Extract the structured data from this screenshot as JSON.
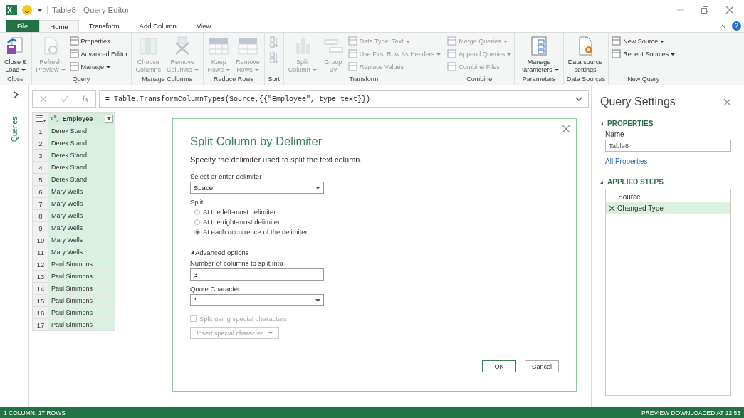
{
  "title_bar": {
    "title": "Table8 - Query Editor"
  },
  "menu_tabs": [
    {
      "label": "File",
      "kind": "file",
      "selected": false
    },
    {
      "label": "Home",
      "kind": "tab",
      "selected": true
    },
    {
      "label": "Transform",
      "kind": "tab",
      "selected": false
    },
    {
      "label": "Add Column",
      "kind": "tab",
      "selected": false
    },
    {
      "label": "View",
      "kind": "tab",
      "selected": false
    }
  ],
  "help": "?",
  "ribbon_groups": [
    {
      "label": "Close",
      "buttons": [
        {
          "kind": "large",
          "lines": [
            "Close &",
            "Load"
          ],
          "dropdown": true,
          "disabled": false
        }
      ]
    },
    {
      "label": "Query",
      "buttons": [
        {
          "kind": "large",
          "lines": [
            "Refresh",
            "Preview"
          ],
          "dropdown": true,
          "disabled": true
        },
        {
          "kind": "small",
          "lines": [
            "Properties"
          ],
          "dropdown": false,
          "disabled": false
        },
        {
          "kind": "small",
          "lines": [
            "Advanced Editor"
          ],
          "dropdown": false,
          "disabled": false
        },
        {
          "kind": "small",
          "lines": [
            "Manage"
          ],
          "dropdown": true,
          "disabled": false
        }
      ]
    },
    {
      "label": "Manage Columns",
      "buttons": [
        {
          "kind": "large",
          "lines": [
            "Choose",
            "Columns"
          ],
          "dropdown": false,
          "disabled": true
        },
        {
          "kind": "large",
          "lines": [
            "Remove",
            "Columns"
          ],
          "dropdown": true,
          "disabled": true
        }
      ]
    },
    {
      "label": "Reduce Rows",
      "buttons": [
        {
          "kind": "large",
          "lines": [
            "Keep",
            "Rows"
          ],
          "dropdown": true,
          "disabled": true
        },
        {
          "kind": "large",
          "lines": [
            "Remove",
            "Rows"
          ],
          "dropdown": true,
          "disabled": true
        }
      ]
    },
    {
      "label": "Sort",
      "buttons": [
        {
          "kind": "icon",
          "disabled": true
        },
        {
          "kind": "icon",
          "disabled": true
        }
      ]
    },
    {
      "label": "Transform",
      "buttons": [
        {
          "kind": "large",
          "lines": [
            "Split",
            "Column"
          ],
          "dropdown": true,
          "disabled": true
        },
        {
          "kind": "large",
          "lines": [
            "Group",
            "By"
          ],
          "dropdown": false,
          "disabled": true
        },
        {
          "kind": "small",
          "lines": [
            "Data Type: Text"
          ],
          "dropdown": true,
          "disabled": true
        },
        {
          "kind": "small",
          "lines": [
            "Use First Row As Headers"
          ],
          "dropdown": true,
          "disabled": true
        },
        {
          "kind": "small",
          "lines": [
            "Replace Values"
          ],
          "dropdown": false,
          "disabled": true
        }
      ]
    },
    {
      "label": "Combine",
      "buttons": [
        {
          "kind": "small",
          "lines": [
            "Merge Queries"
          ],
          "dropdown": true,
          "disabled": true
        },
        {
          "kind": "small",
          "lines": [
            "Append Queries"
          ],
          "dropdown": true,
          "disabled": true
        },
        {
          "kind": "small",
          "lines": [
            "Combine Files"
          ],
          "dropdown": false,
          "disabled": true
        }
      ]
    },
    {
      "label": "Parameters",
      "buttons": [
        {
          "kind": "large",
          "lines": [
            "Manage",
            "Parameters"
          ],
          "dropdown": true,
          "disabled": false
        }
      ]
    },
    {
      "label": "Data Sources",
      "buttons": [
        {
          "kind": "large",
          "lines": [
            "Data source",
            "settings"
          ],
          "dropdown": false,
          "disabled": false
        }
      ]
    },
    {
      "label": "New Query",
      "buttons": [
        {
          "kind": "small",
          "lines": [
            "New Source"
          ],
          "dropdown": true,
          "disabled": false
        },
        {
          "kind": "small",
          "lines": [
            "Recent Sources"
          ],
          "dropdown": true,
          "disabled": false
        }
      ]
    }
  ],
  "queries_pane": {
    "label": "Queries",
    "expanded": false
  },
  "formula_bar": {
    "fx": "fx",
    "formula": "= Table.TransformColumnTypes(Source,{{\"Employee\", type text}})"
  },
  "table": {
    "column": {
      "name": "Employee",
      "type_badge": "A$^{B}$$_{C}$",
      "selected": true
    },
    "rows": [
      {
        "n": "1",
        "value": "Derek Stand"
      },
      {
        "n": "2",
        "value": "Derek Stand"
      },
      {
        "n": "3",
        "value": "Derek Stand"
      },
      {
        "n": "4",
        "value": "Derek Stand"
      },
      {
        "n": "5",
        "value": "Derek Stand"
      },
      {
        "n": "6",
        "value": "Mary Wells"
      },
      {
        "n": "7",
        "value": "Mary Wells"
      },
      {
        "n": "8",
        "value": "Mary Wells"
      },
      {
        "n": "9",
        "value": "Mary Wells"
      },
      {
        "n": "10",
        "value": "Mary Wells"
      },
      {
        "n": "11",
        "value": "Mary Wells"
      },
      {
        "n": "12",
        "value": "Paul Simmons"
      },
      {
        "n": "13",
        "value": "Paul Simmons"
      },
      {
        "n": "14",
        "value": "Paul Simmons"
      },
      {
        "n": "15",
        "value": "Paul Simmons"
      },
      {
        "n": "16",
        "value": "Paul Simmons"
      },
      {
        "n": "17",
        "value": "Paul Simmons"
      }
    ]
  },
  "dialog": {
    "title": "Split Column by Delimiter",
    "description": "Specify the delimiter used to split the text column.",
    "delimiter_label": "Select or enter delimiter",
    "delimiter_value": "Space",
    "split_label": "Split",
    "split_options": [
      {
        "label": "At the left-most delimiter",
        "selected": false
      },
      {
        "label": "At the right-most delimiter",
        "selected": false
      },
      {
        "label": "At each occurrence of the delimiter",
        "selected": true
      }
    ],
    "advanced_label": "Advanced options",
    "advanced_expanded": true,
    "columns_label": "Number of columns to split into",
    "columns_value": "3",
    "quote_label": "Quote Character",
    "quote_value": "\"",
    "special_chars": {
      "label": "Split using special characters",
      "checked": false,
      "disabled": true
    },
    "insert_button": {
      "label": "Insert special character",
      "disabled": true
    },
    "ok": "OK",
    "cancel": "Cancel"
  },
  "query_settings": {
    "title": "Query Settings",
    "properties_heading": "PROPERTIES",
    "properties_expanded": true,
    "name_label": "Name",
    "name_value": "Table8",
    "all_properties": "All Properties",
    "steps_heading": "APPLIED STEPS",
    "steps_expanded": true,
    "steps": [
      {
        "label": "Source",
        "selected": false
      },
      {
        "label": "Changed Type",
        "selected": true
      }
    ]
  },
  "status_bar": {
    "left": "1 COLUMN, 17 ROWS",
    "right": "PREVIEW DOWNLOADED AT 12:53"
  }
}
